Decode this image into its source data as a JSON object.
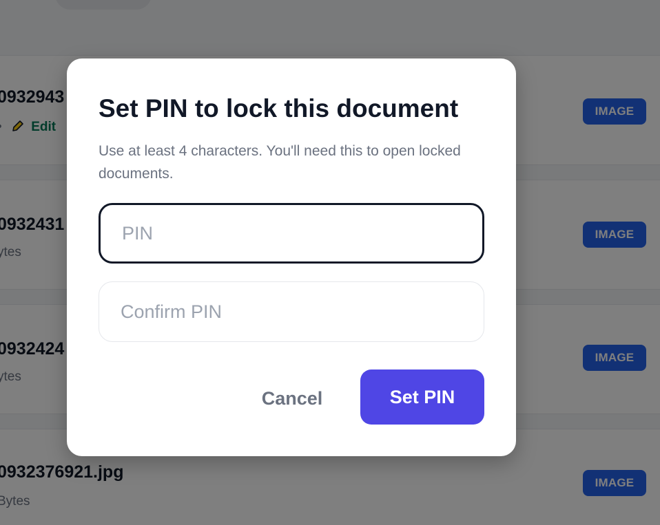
{
  "documents": [
    {
      "name": "0932943",
      "meta": "",
      "edit_label": "Edit",
      "badge": "IMAGE"
    },
    {
      "name": "0932431",
      "meta": "ytes",
      "badge": "IMAGE"
    },
    {
      "name": "0932424",
      "meta": "ytes",
      "badge": "IMAGE"
    },
    {
      "name": "0932376921.jpg",
      "meta": "Bytes",
      "badge": "IMAGE"
    }
  ],
  "modal": {
    "title": "Set PIN to lock this document",
    "description": "Use at least 4 characters. You'll need this to open locked documents.",
    "pin_placeholder": "PIN",
    "pin_value": "",
    "confirm_placeholder": "Confirm PIN",
    "confirm_value": "",
    "cancel_label": "Cancel",
    "submit_label": "Set PIN"
  },
  "icons": {
    "edit": "pencil-icon"
  },
  "colors": {
    "overlay": "rgba(0,0,0,0.5)",
    "primary": "#4f46e5",
    "badge": "#2563eb",
    "edit": "#047857"
  }
}
